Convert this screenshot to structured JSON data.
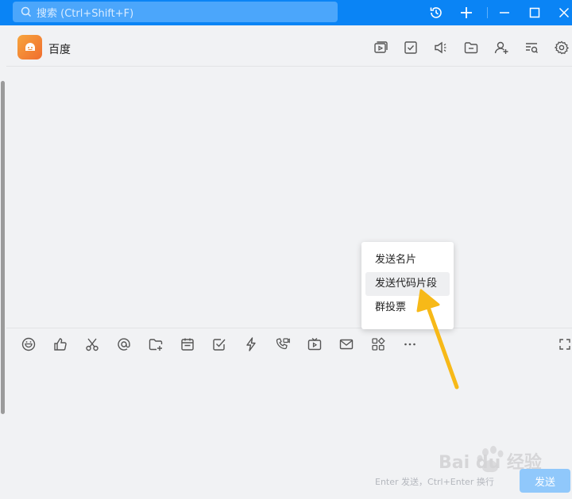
{
  "search": {
    "placeholder": "搜索 (Ctrl+Shift+F)"
  },
  "chat": {
    "title": "百度"
  },
  "popup": {
    "items": [
      {
        "label": "发送名片"
      },
      {
        "label": "发送代码片段"
      },
      {
        "label": "群投票"
      }
    ]
  },
  "composer": {
    "hint": "Enter 发送，Ctrl+Enter 换行",
    "send_label": "发送"
  },
  "watermark": {
    "text": "Bai du 经验"
  },
  "icons": {
    "titlebar": [
      "search-icon",
      "history-icon",
      "plus-icon",
      "minimize-icon",
      "maximize-icon",
      "close-icon"
    ],
    "header": [
      "video-album-icon",
      "todo-check-icon",
      "announcement-icon",
      "folder-icon",
      "add-member-icon",
      "search-record-icon",
      "settings-icon"
    ],
    "toolbar": [
      "emoji-icon",
      "thumbs-up-icon",
      "scissors-icon",
      "at-icon",
      "folder-plus-icon",
      "calendar-icon",
      "task-check-icon",
      "lightning-icon",
      "phone-video-icon",
      "tv-live-icon",
      "mail-icon",
      "apps-icon",
      "more-icon",
      "expand-icon"
    ]
  },
  "colors": {
    "titlebar": "#0a84f5",
    "send_button": "#90c8fb",
    "arrow": "#f7b918"
  }
}
